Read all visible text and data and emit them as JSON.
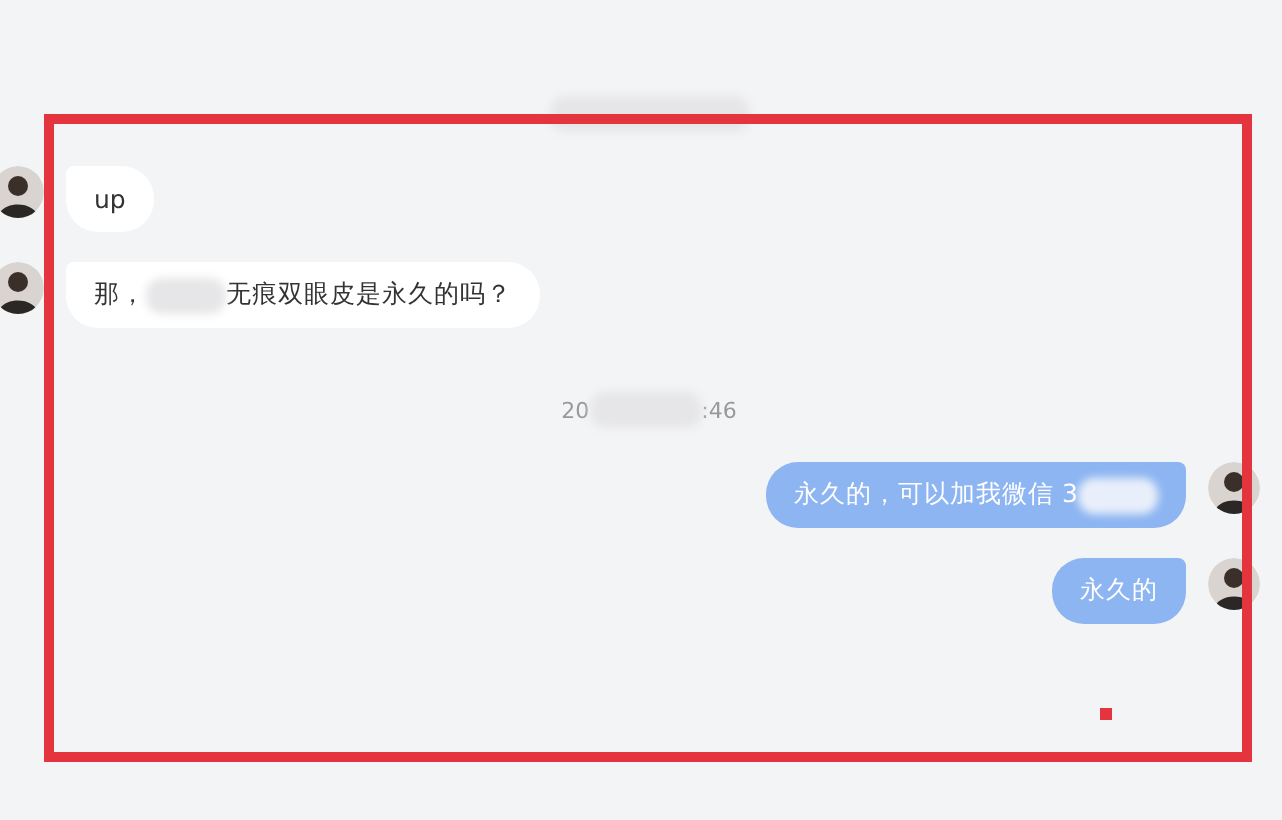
{
  "messages": [
    {
      "kind": "time",
      "segments": [
        {
          "kind": "blur"
        }
      ]
    },
    {
      "kind": "bubble",
      "outgoing": false,
      "segments": [
        {
          "kind": "text",
          "text": "up"
        }
      ]
    },
    {
      "kind": "bubble",
      "outgoing": false,
      "segments": [
        {
          "kind": "text",
          "text": "那，"
        },
        {
          "kind": "blur"
        },
        {
          "kind": "text",
          "text": "无痕双眼皮是永久的吗？"
        }
      ]
    },
    {
      "kind": "time",
      "segments": [
        {
          "kind": "text",
          "text": "20"
        },
        {
          "kind": "blur"
        },
        {
          "kind": "text",
          "text": ":46"
        }
      ]
    },
    {
      "kind": "bubble",
      "outgoing": true,
      "segments": [
        {
          "kind": "text",
          "text": "永久的，可以加我微信 3"
        },
        {
          "kind": "blur"
        }
      ]
    },
    {
      "kind": "bubble",
      "outgoing": true,
      "segments": [
        {
          "kind": "text",
          "text": "永久的"
        }
      ]
    }
  ],
  "annotation": {
    "kind": "frame",
    "color": "#e4343e"
  }
}
